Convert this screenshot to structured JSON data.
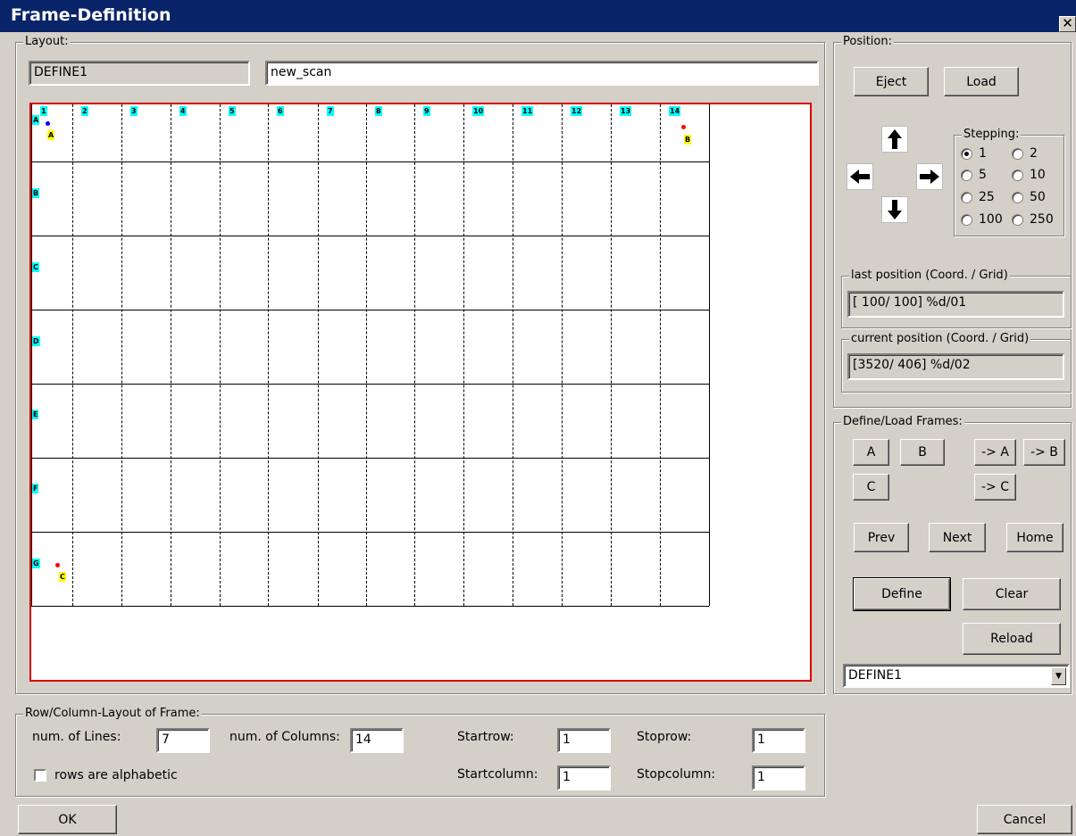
{
  "window": {
    "title": "Frame-Definition",
    "close_glyph": "✕"
  },
  "layout": {
    "legend": "Layout:",
    "define_name": "DEFINE1",
    "scan_name": "new_scan",
    "column_labels": [
      "1",
      "2",
      "3",
      "4",
      "5",
      "6",
      "7",
      "8",
      "9",
      "10",
      "11",
      "12",
      "13",
      "14"
    ],
    "row_labels": [
      "A",
      "B",
      "C",
      "D",
      "E",
      "F",
      "G"
    ],
    "markers": {
      "a": "A",
      "b": "B",
      "c": "C"
    },
    "colors": {
      "canvas_border": "#d80000",
      "label_bg": "#00ffff",
      "marker_bg": "#ffff00",
      "dot_blue": "#0000ff",
      "dot_red": "#ff0000"
    }
  },
  "position": {
    "legend": "Position:",
    "eject": "Eject",
    "load": "Load",
    "icons": {
      "up": "up-arrow-icon",
      "down": "down-arrow-icon",
      "left": "left-arrow-icon",
      "right": "right-arrow-icon"
    },
    "stepping": {
      "legend": "Stepping:",
      "options": [
        "1",
        "2",
        "5",
        "10",
        "25",
        "50",
        "100",
        "250"
      ],
      "selected": "1"
    },
    "last": {
      "legend": "last position (Coord. / Grid)",
      "value": "[ 100/ 100]  %d/01"
    },
    "current": {
      "legend": "current position (Coord. / Grid)",
      "value": "[3520/ 406]  %d/02"
    }
  },
  "frames": {
    "legend": "Define/Load Frames:",
    "a": "A",
    "b": "B",
    "c": "C",
    "go_a": "-> A",
    "go_b": "-> B",
    "go_c": "-> C",
    "prev": "Prev",
    "next": "Next",
    "home": "Home",
    "define": "Define",
    "clear": "Clear",
    "reload": "Reload",
    "select_value": "DEFINE1"
  },
  "rowcol": {
    "legend": "Row/Column-Layout of Frame:",
    "lines_label": "num. of Lines:",
    "lines_value": "7",
    "cols_label": "num. of Columns:",
    "cols_value": "14",
    "startrow_label": "Startrow:",
    "startrow_value": "1",
    "stoprow_label": "Stoprow:",
    "stoprow_value": "1",
    "startcol_label": "Startcolumn:",
    "startcol_value": "1",
    "stopcol_label": "Stopcolumn:",
    "stopcol_value": "1",
    "alpha_label": "rows are alphabetic",
    "alpha_checked": false
  },
  "footer": {
    "ok": "OK",
    "cancel": "Cancel"
  }
}
